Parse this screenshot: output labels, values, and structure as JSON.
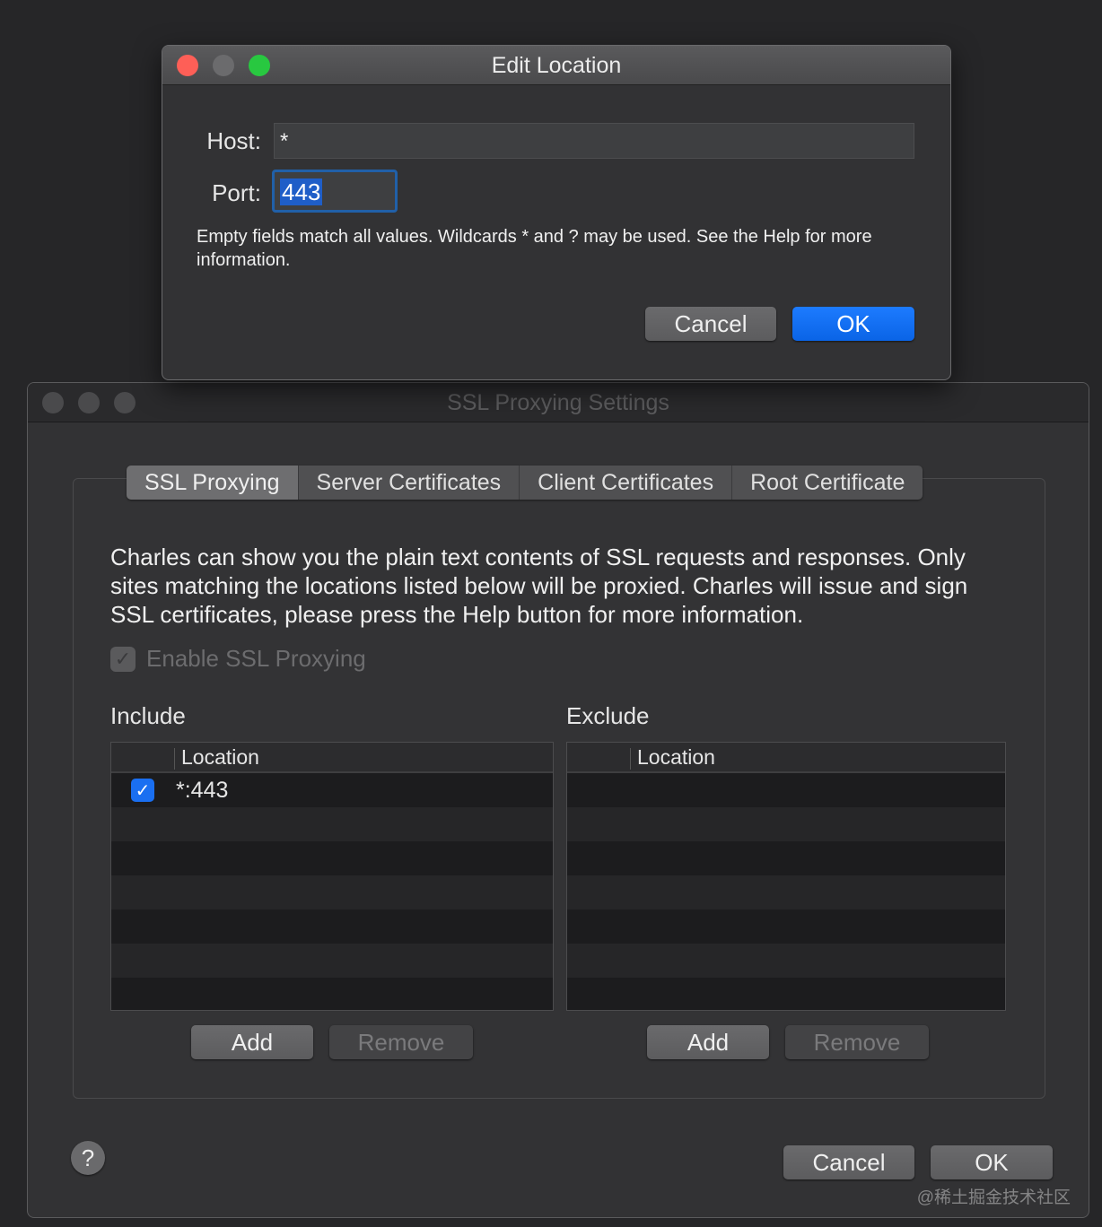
{
  "edit_dialog": {
    "title": "Edit Location",
    "host_label": "Host:",
    "host_value": "*",
    "port_label": "Port:",
    "port_value": "443",
    "help_text": "Empty fields match all values. Wildcards * and ? may be used. See the Help for more information.",
    "cancel_label": "Cancel",
    "ok_label": "OK"
  },
  "settings_window": {
    "title": "SSL Proxying Settings",
    "tabs": [
      "SSL Proxying",
      "Server Certificates",
      "Client Certificates",
      "Root Certificate"
    ],
    "active_tab": "SSL Proxying",
    "description": "Charles can show you the plain text contents of SSL requests and responses. Only sites matching the locations listed below will be proxied. Charles will issue and sign SSL certificates, please press the Help button for more information.",
    "enable_ssl_label": "Enable SSL Proxying",
    "enable_ssl_checked": true,
    "include": {
      "label": "Include",
      "column": "Location",
      "rows": [
        {
          "checked": true,
          "location": "*:443"
        }
      ],
      "add_label": "Add",
      "remove_label": "Remove"
    },
    "exclude": {
      "label": "Exclude",
      "column": "Location",
      "rows": [],
      "add_label": "Add",
      "remove_label": "Remove"
    },
    "help_label": "?",
    "cancel_label": "Cancel",
    "ok_label": "OK"
  },
  "watermark": "@稀土掘金技术社区",
  "colors": {
    "accent_blue": "#0a64e6",
    "close_red": "#fe5f57",
    "zoom_green": "#28c840",
    "minimize_inactive": "#6b6b6d"
  },
  "icons": {
    "check": "✓",
    "help": "?"
  }
}
